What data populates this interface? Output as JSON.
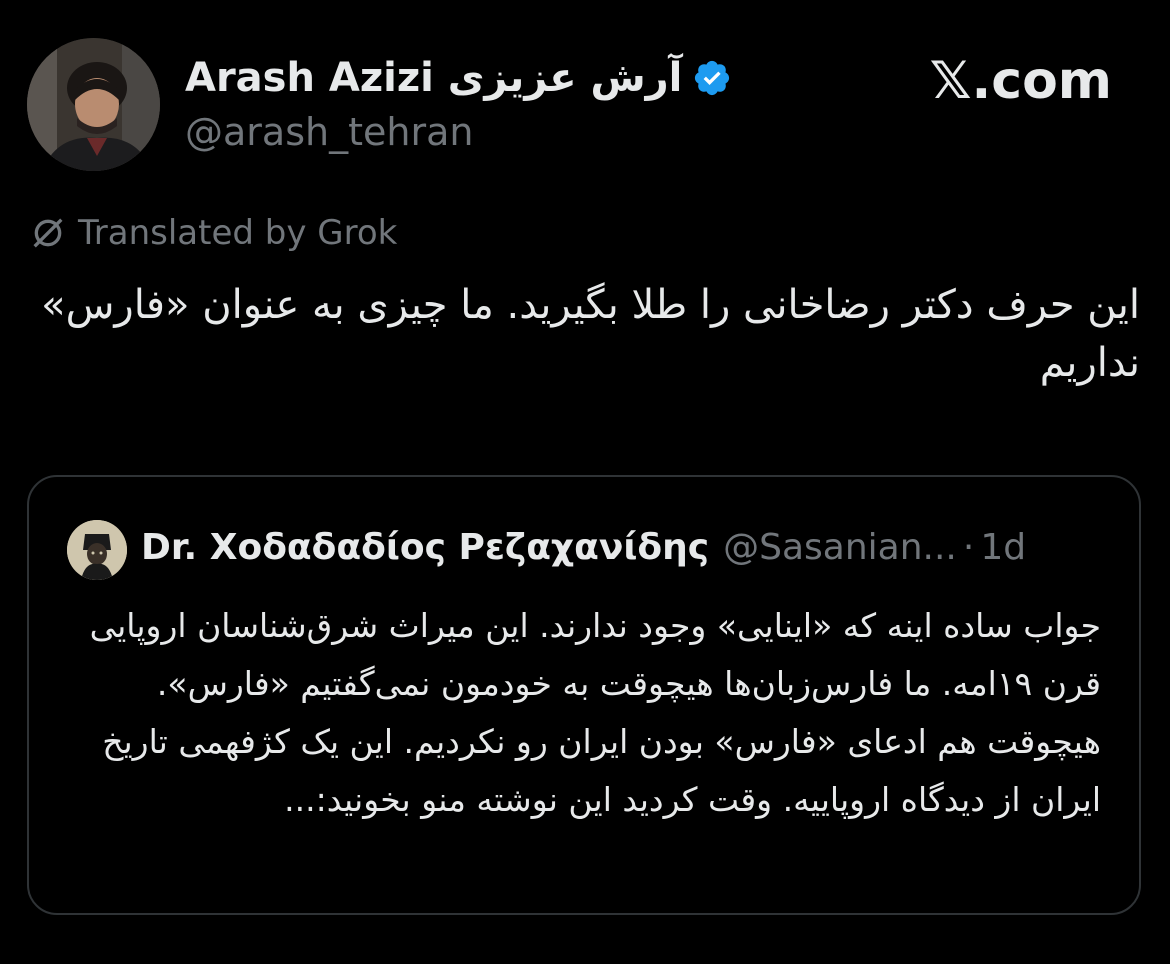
{
  "author": {
    "name": "Arash Azizi آرش عزیزی",
    "handle": "@arash_tehran",
    "verified": true,
    "avatar_icon": "profile-photo"
  },
  "site": {
    "label": "𝕏.com"
  },
  "translation": {
    "label": "Translated by Grok",
    "icon": "translate-off-icon"
  },
  "post": {
    "text": "این حرف دکتر رضاخانی را طلا بگیرید. ما چیزی به عنوان «فارس» نداریم"
  },
  "quoted_post": {
    "name": "Dr. Χοδαδαδίος Ρεζαχανίδης",
    "handle": "@Sasanian...",
    "separator": "·",
    "time": "1d",
    "avatar_icon": "profile-photo",
    "text": "جواب ساده اینه که «اینایی» وجود ندارند. این میراث شرق‌شناسان اروپایی قرن ۱۹امه. ما فارس‌زبان‌ها هیچوقت به خودمون نمی‌گفتیم «فارس». هیچوقت هم ادعای «فارس» بودن ایران رو نکردیم. این یک کژفهمی تاریخ ایران از دیدگاه اروپاییه. وقت کردید این نوشته منو بخونید:..."
  },
  "colors": {
    "background": "#000000",
    "text_primary": "#e7e9ea",
    "text_secondary": "#71767b",
    "verified_blue": "#1d9bf0",
    "card_border": "#2f3336"
  }
}
